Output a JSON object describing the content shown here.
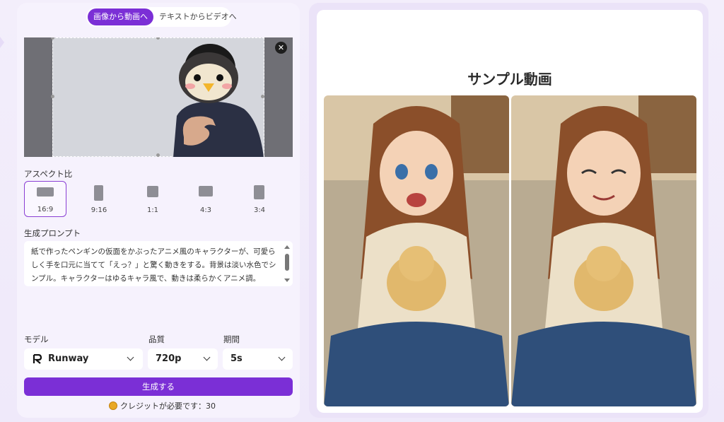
{
  "tabs": [
    {
      "label": "画像から動画へ",
      "active": true
    },
    {
      "label": "テキストからビデオへ",
      "active": false
    }
  ],
  "preview": {
    "close_icon": "close-icon"
  },
  "aspect": {
    "label": "アスペクト比",
    "options": [
      {
        "label": "16:9",
        "selected": true
      },
      {
        "label": "9:16",
        "selected": false
      },
      {
        "label": "1:1",
        "selected": false
      },
      {
        "label": "4:3",
        "selected": false
      },
      {
        "label": "3:4",
        "selected": false
      }
    ]
  },
  "prompt": {
    "label": "生成プロンプト",
    "text": "紙で作ったペンギンの仮面をかぶったアニメ風のキャラクターが、可愛らしく手を口元に当てて「えっ？」と驚く動きをする。背景は淡い水色でシンプル。キャラクターはゆるキャラ風で、動きは柔らかくアニメ調。"
  },
  "settings": {
    "model": {
      "label": "モデル",
      "value": "Runway"
    },
    "quality": {
      "label": "品質",
      "value": "720p"
    },
    "duration": {
      "label": "期間",
      "value": "5s"
    }
  },
  "generate_label": "生成する",
  "credits_text": "クレジットが必要です：30",
  "sample": {
    "title": "サンプル動画"
  },
  "colors": {
    "accent": "#7b2fd6",
    "panel": "#f6f2fd"
  }
}
